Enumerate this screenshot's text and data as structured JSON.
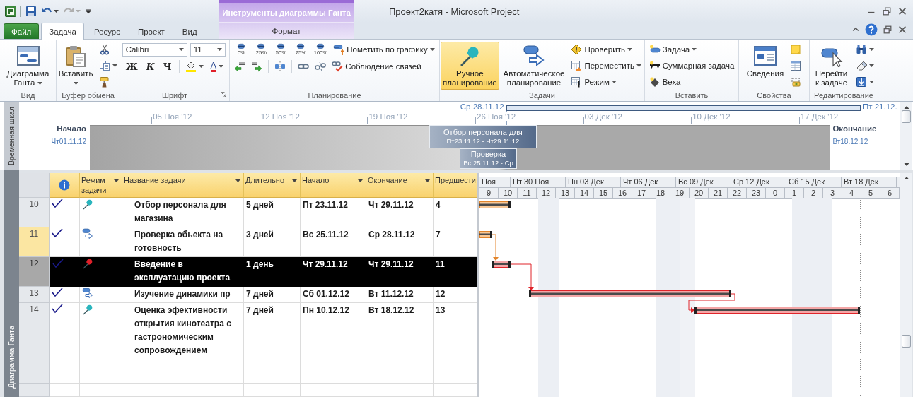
{
  "window": {
    "title": "Проект2катя - Microsoft Project"
  },
  "quick_access": [
    {
      "kind": "save",
      "dropdown": false
    },
    {
      "kind": "undo",
      "dropdown": true
    },
    {
      "kind": "redo",
      "dropdown": true,
      "disabled": true
    },
    {
      "kind": "customize",
      "dropdown": false
    }
  ],
  "contextual_tab_group": {
    "label": "Инструменты диаграммы Ганта"
  },
  "tabs": [
    {
      "label": "Файл",
      "kind": "file",
      "selected": false
    },
    {
      "label": "Задача",
      "kind": "standard",
      "selected": true
    },
    {
      "label": "Ресурс",
      "kind": "standard",
      "selected": false
    },
    {
      "label": "Проект",
      "kind": "standard",
      "selected": false
    },
    {
      "label": "Вид",
      "kind": "standard",
      "selected": false
    },
    {
      "label": "Формат",
      "kind": "contextual",
      "selected": false
    }
  ],
  "ribbon": {
    "groups": [
      {
        "label": "Вид",
        "items": [
          {
            "kind": "large",
            "label": "Диаграмма Ганта",
            "dropdown": true
          }
        ]
      },
      {
        "label": "Буфер обмена",
        "items": [
          {
            "kind": "large",
            "label": "Вставить",
            "dropdown": true
          },
          {
            "kind": "stack",
            "items": [
              {
                "kind": "icon",
                "dropdown": false
              },
              {
                "kind": "icon",
                "dropdown": true
              },
              {
                "kind": "icon",
                "dropdown": false
              }
            ]
          }
        ]
      },
      {
        "label": "Шрифт",
        "launcher": true,
        "items": [
          {
            "kind": "stack",
            "items": [
              {
                "kind": "row",
                "items": [
                  {
                    "kind": "combo",
                    "value": "Calibri"
                  },
                  {
                    "kind": "combo",
                    "value": "11"
                  }
                ]
              },
              {
                "kind": "row",
                "items": [
                  {
                    "kind": "text-button",
                    "label": "Ж",
                    "dropdown": false
                  },
                  {
                    "kind": "text-button",
                    "label": "К",
                    "dropdown": false
                  },
                  {
                    "kind": "text-button",
                    "label": "Ч",
                    "dropdown": false
                  },
                  {
                    "kind": "separator"
                  },
                  {
                    "kind": "icon",
                    "dropdown": true
                  },
                  {
                    "kind": "text-button",
                    "label": "A",
                    "dropdown": true
                  }
                ]
              }
            ]
          }
        ]
      },
      {
        "label": "Планирование",
        "items": [
          {
            "kind": "stack",
            "items": [
              {
                "kind": "row",
                "items": [
                  {
                    "kind": "percent",
                    "label": "0%"
                  },
                  {
                    "kind": "percent",
                    "label": "25%"
                  },
                  {
                    "kind": "percent",
                    "label": "50%"
                  },
                  {
                    "kind": "percent",
                    "label": "75%"
                  },
                  {
                    "kind": "percent",
                    "label": "100%"
                  },
                  {
                    "kind": "small",
                    "label": "Пометить по графику",
                    "dropdown": true
                  }
                ]
              },
              {
                "kind": "row",
                "items": [
                  {
                    "kind": "icon",
                    "dropdown": false
                  },
                  {
                    "kind": "icon",
                    "dropdown": false
                  },
                  {
                    "kind": "separator"
                  },
                  {
                    "kind": "icon",
                    "dropdown": false
                  },
                  {
                    "kind": "separator"
                  },
                  {
                    "kind": "icon",
                    "dropdown": false
                  },
                  {
                    "kind": "icon",
                    "dropdown": false
                  },
                  {
                    "kind": "small",
                    "label": "Соблюдение связей",
                    "dropdown": false
                  }
                ]
              }
            ]
          }
        ]
      },
      {
        "label": "Задачи",
        "items": [
          {
            "kind": "large",
            "label": "Ручное планирование",
            "dropdown": false,
            "selected": true
          },
          {
            "kind": "large",
            "label": "Автоматическое планирование",
            "dropdown": false,
            "selected": false
          },
          {
            "kind": "stack",
            "items": [
              {
                "kind": "small",
                "label": "Проверить",
                "dropdown": true
              },
              {
                "kind": "small",
                "label": "Переместить",
                "dropdown": true
              },
              {
                "kind": "small",
                "label": "Режим",
                "dropdown": true
              }
            ]
          }
        ]
      },
      {
        "label": "Вставить",
        "items": [
          {
            "kind": "stack",
            "items": [
              {
                "kind": "small",
                "label": "Задача",
                "dropdown": true
              },
              {
                "kind": "small",
                "label": "Суммарная задача",
                "dropdown": false
              },
              {
                "kind": "small",
                "label": "Веха",
                "dropdown": false
              }
            ]
          }
        ]
      },
      {
        "label": "Свойства",
        "items": [
          {
            "kind": "large",
            "label": "Сведения",
            "dropdown": false
          },
          {
            "kind": "stack",
            "items": [
              {
                "kind": "icon",
                "dropdown": false
              },
              {
                "kind": "icon",
                "dropdown": false
              },
              {
                "kind": "icon",
                "dropdown": false
              }
            ]
          }
        ]
      },
      {
        "label": "Редактирование",
        "items": [
          {
            "kind": "large",
            "label": "Перейти к задаче",
            "dropdown": false
          },
          {
            "kind": "stack",
            "items": [
              {
                "kind": "icon",
                "dropdown": true
              },
              {
                "kind": "icon",
                "dropdown": true
              },
              {
                "kind": "icon",
                "dropdown": true
              }
            ]
          }
        ]
      }
    ]
  },
  "timeline": {
    "label": "Временная шкал",
    "view_start": "Ср 28.11.12",
    "view_end": "Пт 21.12.",
    "ticks": [
      "05 Ноя '12",
      "12 Ноя '12",
      "19 Ноя '12",
      "26 Ноя '12",
      "03 Дек '12",
      "10 Дек '12",
      "17 Дек '12"
    ],
    "start_label": "Начало",
    "start_date": "Чт01.11.12",
    "end_label": "Окончание",
    "end_date": "Вт18.12.12",
    "tasks": [
      {
        "name": "Отбор персонала для",
        "dates": "Пт23.11.12 - Чт29.11.12"
      },
      {
        "name": "Проверка",
        "dates": "Вс 25.11.12 - Ср"
      }
    ]
  },
  "view_bar": {
    "label": "Диаграмма Ганта"
  },
  "table": {
    "columns": [
      {
        "kind": "info"
      },
      {
        "kind": "text",
        "label": "Режим задачи",
        "dropdown": true
      },
      {
        "kind": "text",
        "label": "Название задачи",
        "dropdown": true
      },
      {
        "kind": "text",
        "label": "Длительно",
        "dropdown": true
      },
      {
        "kind": "text",
        "label": "Начало",
        "dropdown": true
      },
      {
        "kind": "text",
        "label": "Окончание",
        "dropdown": true
      },
      {
        "kind": "text",
        "label": "Предшести"
      }
    ],
    "rows": [
      {
        "id": "10",
        "done": true,
        "manual": true,
        "name": "Отбор персонала для магазина",
        "duration": "5 дней",
        "start": "Пт 23.11.12",
        "finish": "Чт 29.11.12",
        "predecessors": "4",
        "critical": false,
        "selected": false,
        "highlighted": false
      },
      {
        "id": "11",
        "done": true,
        "manual": false,
        "name": "Проверка обьекта на готовность",
        "duration": "3 дней",
        "start": "Вс 25.11.12",
        "finish": "Ср 28.11.12",
        "predecessors": "7",
        "critical": false,
        "selected": false,
        "highlighted": true
      },
      {
        "id": "12",
        "done": true,
        "manual": true,
        "name": "Введение в эксплуатацию проекта",
        "duration": "1 день",
        "start": "Чт 29.11.12",
        "finish": "Чт 29.11.12",
        "predecessors": "11",
        "critical": true,
        "selected": true,
        "highlighted": false
      },
      {
        "id": "13",
        "done": true,
        "manual": false,
        "name": "Изучение динамики пр",
        "duration": "7 дней",
        "start": "Сб 01.12.12",
        "finish": "Вт 11.12.12",
        "predecessors": "12",
        "critical": true,
        "selected": false,
        "highlighted": false
      },
      {
        "id": "14",
        "done": true,
        "manual": true,
        "name": "Оценка эфективности открытия кинотеатра с гастрономическим сопровождением",
        "duration": "7 дней",
        "start": "Пн 10.12.12",
        "finish": "Вт 18.12.12",
        "predecessors": "13",
        "critical": true,
        "selected": false,
        "highlighted": false
      }
    ]
  },
  "gantt": {
    "top_tier": [
      "Ноя",
      "Пт 30 Ноя",
      "Пн 03 Дек",
      "Чт 06 Дек",
      "Вс 09 Дек",
      "Ср 12 Дек",
      "Сб 15 Дек",
      "Вт 18 Дек"
    ],
    "bottom_tier": [
      "9",
      "10",
      "11",
      "12",
      "13",
      "14",
      "15",
      "16",
      "17",
      "18",
      "19",
      "20",
      "21",
      "22",
      "23",
      "0",
      "1",
      "2",
      "3",
      "4",
      "5",
      "6"
    ]
  }
}
